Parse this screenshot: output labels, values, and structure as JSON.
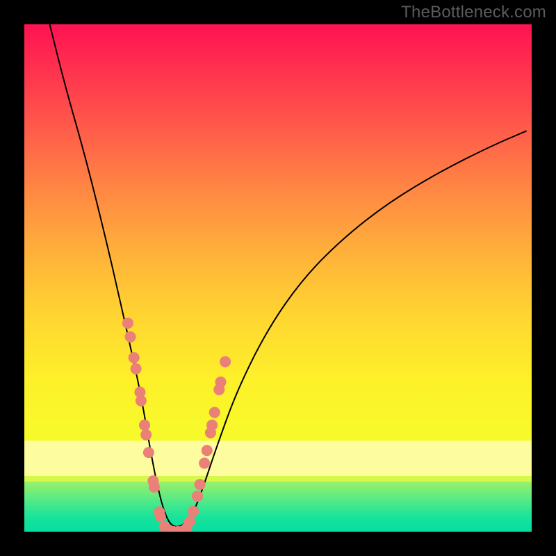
{
  "watermark": "TheBottleneck.com",
  "chart_data": {
    "type": "line",
    "title": "",
    "xlabel": "",
    "ylabel": "",
    "xlim": [
      0,
      100
    ],
    "ylim": [
      0,
      100
    ],
    "grid": false,
    "series": [
      {
        "name": "bottleneck-curve",
        "color": "#000000",
        "x": [
          5,
          8,
          12,
          16,
          19,
          21,
          23,
          24.5,
          26,
          27.5,
          29,
          31,
          33,
          35,
          38,
          42,
          48,
          55,
          63,
          72,
          82,
          92,
          99
        ],
        "y": [
          100,
          88,
          74,
          58,
          45,
          36,
          27,
          18,
          10,
          4,
          1,
          1,
          3,
          8,
          17,
          28,
          40,
          50,
          58,
          65,
          71,
          76,
          79
        ]
      }
    ],
    "markers": [
      {
        "name": "left-branch-dots",
        "color": "#eb8079",
        "points": [
          [
            20.4,
            41.1
          ],
          [
            20.9,
            38.4
          ],
          [
            21.6,
            34.3
          ],
          [
            22.0,
            32.1
          ],
          [
            22.8,
            27.5
          ],
          [
            23.0,
            25.8
          ],
          [
            23.7,
            21.0
          ],
          [
            24.0,
            19.1
          ],
          [
            24.5,
            15.6
          ],
          [
            25.4,
            10.0
          ],
          [
            25.6,
            8.8
          ],
          [
            26.6,
            3.9
          ],
          [
            26.8,
            3.0
          ],
          [
            27.6,
            1.0
          ]
        ]
      },
      {
        "name": "valley-dots",
        "color": "#eb8079",
        "points": [
          [
            28.5,
            0.3
          ],
          [
            29.4,
            0.0
          ],
          [
            30.3,
            0.0
          ],
          [
            31.2,
            0.1
          ],
          [
            32.0,
            0.7
          ]
        ]
      },
      {
        "name": "right-branch-dots",
        "color": "#eb8079",
        "points": [
          [
            32.6,
            2.0
          ],
          [
            33.3,
            4.0
          ],
          [
            34.1,
            7.0
          ],
          [
            34.6,
            9.3
          ],
          [
            35.5,
            13.5
          ],
          [
            36.0,
            16.0
          ],
          [
            36.7,
            19.5
          ],
          [
            37.0,
            21.0
          ],
          [
            37.5,
            23.5
          ],
          [
            38.4,
            28.0
          ],
          [
            38.7,
            29.5
          ],
          [
            39.6,
            33.5
          ]
        ]
      }
    ],
    "background_bands": [
      {
        "from_y": 18,
        "to_y": 100,
        "style": "gradient-red-to-yellow"
      },
      {
        "from_y": 11,
        "to_y": 18,
        "style": "pale-yellow"
      },
      {
        "from_y": 9.8,
        "to_y": 11,
        "style": "yellow-green"
      },
      {
        "from_y": 0,
        "to_y": 9.8,
        "style": "green-gradient"
      }
    ]
  }
}
